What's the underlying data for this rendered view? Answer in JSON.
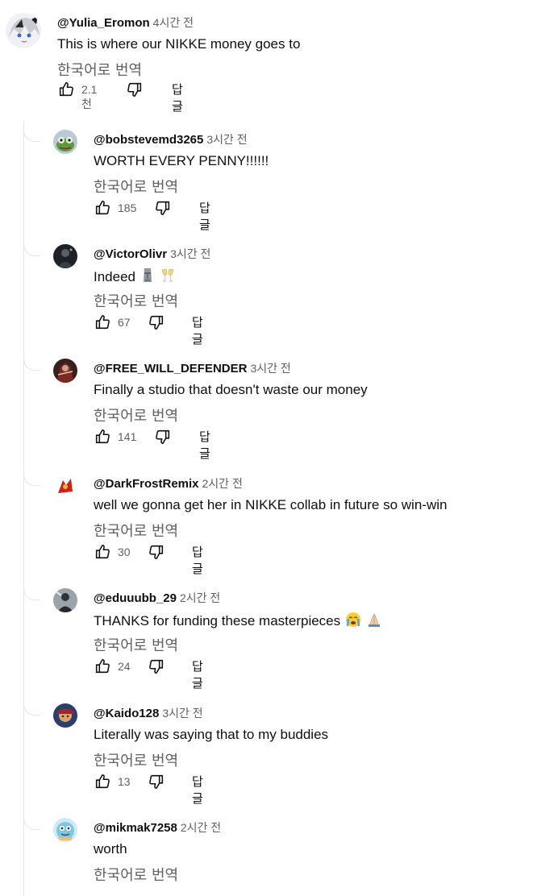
{
  "translate_label": "한국어로 번역",
  "reply_label": "답글",
  "comments": [
    {
      "author": "@Yulia_Eromon",
      "time": "4시간 전",
      "text": "This is where our NIKKE money goes to",
      "likes": "2.1천",
      "avatar": "anime-girl"
    },
    {
      "author": "@bobstevemd3265",
      "time": "3시간 전",
      "text": "WORTH EVERY PENNY!!!!!!",
      "likes": "185",
      "avatar": "frog"
    },
    {
      "author": "@VictorOlivr",
      "time": "3시간 전",
      "text": "Indeed",
      "likes": "67",
      "avatar": "dark-figure",
      "emojis": [
        "moai",
        "clinking-glasses"
      ]
    },
    {
      "author": "@FREE_WILL_DEFENDER",
      "time": "3시간 전",
      "text": "Finally a studio that doesn't waste our money",
      "likes": "141",
      "avatar": "warrior"
    },
    {
      "author": "@DarkFrostRemix",
      "time": "2시간 전",
      "text": "well we gonna get her in NIKKE collab in future so win-win",
      "likes": "30",
      "avatar": "red-creature"
    },
    {
      "author": "@eduuubb_29",
      "time": "2시간 전",
      "text": "THANKS for funding these masterpieces",
      "likes": "24",
      "avatar": "soldier",
      "emojis": [
        "loudly-crying-face",
        "folded-hands"
      ]
    },
    {
      "author": "@Kaido128",
      "time": "3시간 전",
      "text": "Literally was saying that to my buddies",
      "likes": "13",
      "avatar": "pirate"
    },
    {
      "author": "@mikmak7258",
      "time": "2시간 전",
      "text": "worth",
      "likes": "",
      "avatar": "squirtle"
    }
  ],
  "colors": {
    "text": "#0f0f0f",
    "secondary": "#606060",
    "line": "#e5e5e5"
  }
}
